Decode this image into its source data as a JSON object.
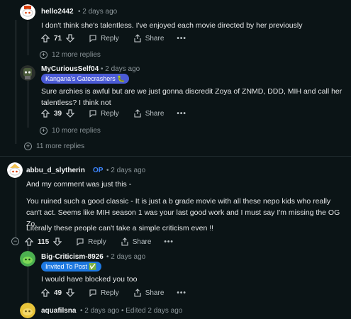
{
  "comments": [
    {
      "user": "hello2442",
      "time": "• 2 days ago",
      "text": "I don't think she's talentless. I've enjoyed each movie directed by her previously",
      "votes": "71",
      "reply": "Reply",
      "share": "Share",
      "dots": "•••",
      "more_replies": "12 more replies"
    },
    {
      "user": "MyCuriousSelf04",
      "time": "• 2 days ago",
      "flair": "Kangana's Gatecrashers 🐛",
      "text": "Sure archies is awful but are we just gonna discredit Zoya of ZNMD, DDD, MIH and call her talentless? I think not",
      "votes": "39",
      "reply": "Reply",
      "share": "Share",
      "dots": "•••",
      "more_replies": "10 more replies"
    },
    {
      "thread_more": "11 more replies"
    },
    {
      "user": "abbu_d_slytherin",
      "op": "OP",
      "time": "• 2 days ago",
      "para1": "And my comment was just this -",
      "para2": "You ruined such a good classic - It is just a b grade movie with all these nepo kids who really can't act. Seems like MIH season 1 was your last good work and I must say I'm missing the OG Zo.",
      "para3": "Literally these people can't take a simple criticism even !!",
      "votes": "115",
      "reply": "Reply",
      "share": "Share",
      "dots": "•••"
    },
    {
      "user": "Big-Criticism-8926",
      "time": "• 2 days ago",
      "flair": "Invited To Post ✅",
      "text": "I would have blocked you too",
      "votes": "49",
      "reply": "Reply",
      "share": "Share",
      "dots": "•••"
    },
    {
      "user": "aquafilsna",
      "time": "• 2 days ago • Edited 2 days ago"
    }
  ],
  "colors": {
    "bg": "#0b1416",
    "flair_kangana": "#4b5bd6",
    "flair_invited": "#1d78e0",
    "op": "#3d86ff"
  },
  "icons": [
    "snoo-avatar-icon",
    "upvote-icon",
    "downvote-icon",
    "reply-icon",
    "share-icon",
    "expand-icon",
    "collapse-icon"
  ]
}
